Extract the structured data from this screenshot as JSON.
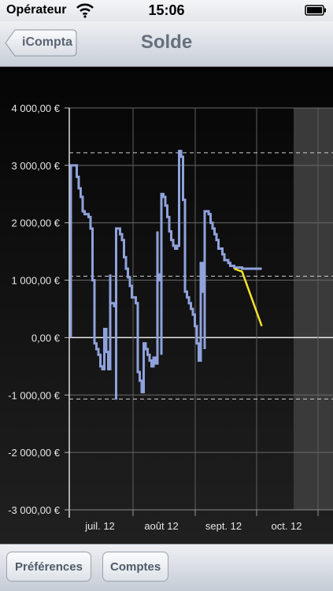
{
  "status_bar": {
    "carrier": "Opérateur",
    "time": "15:06"
  },
  "navbar": {
    "back_label": "iCompta",
    "title": "Solde"
  },
  "toolbar": {
    "preferences_label": "Préférences",
    "accounts_label": "Comptes"
  },
  "colors": {
    "balance_line": "#8fa2dc",
    "forecast_line": "#f0e22a",
    "reference_lines": "#cfcfcf"
  },
  "chart_data": {
    "type": "line",
    "title": "",
    "ylim": [
      -3000,
      4000
    ],
    "yticks": [
      4000,
      3000,
      2000,
      1000,
      0,
      -1000,
      -2000,
      -3000
    ],
    "ytick_labels": [
      "4 000,00 €",
      "3 000,00 €",
      "2 000,00 €",
      "1 000,00 €",
      "0,00 €",
      "-1 000,00 €",
      "-2 000,00 €",
      "-3 000,00 €"
    ],
    "x_ticks": [
      "juil. 12",
      "août 12",
      "sept. 12",
      "oct. 12"
    ],
    "reference_lines": [
      3220,
      1070,
      -1070
    ],
    "series": [
      {
        "color": "balance",
        "points": [
          [
            "2012-06-25",
            0
          ],
          [
            "2012-06-25",
            3000
          ],
          [
            "2012-06-27",
            3000
          ],
          [
            "2012-06-28",
            2800
          ],
          [
            "2012-06-29",
            2600
          ],
          [
            "2012-06-30",
            2450
          ],
          [
            "2012-07-01",
            2200
          ],
          [
            "2012-07-02",
            2150
          ],
          [
            "2012-07-04",
            2100
          ],
          [
            "2012-07-05",
            1900
          ],
          [
            "2012-07-06",
            1000
          ],
          [
            "2012-07-07",
            -100
          ],
          [
            "2012-07-08",
            -200
          ],
          [
            "2012-07-09",
            -300
          ],
          [
            "2012-07-10",
            -500
          ],
          [
            "2012-07-11",
            -550
          ],
          [
            "2012-07-12",
            150
          ],
          [
            "2012-07-13",
            -250
          ],
          [
            "2012-07-14",
            -550
          ],
          [
            "2012-07-15",
            1100
          ],
          [
            "2012-07-15",
            600
          ],
          [
            "2012-07-17",
            550
          ],
          [
            "2012-07-18",
            -1080
          ],
          [
            "2012-07-18",
            1900
          ],
          [
            "2012-07-20",
            1800
          ],
          [
            "2012-07-21",
            1700
          ],
          [
            "2012-07-22",
            1400
          ],
          [
            "2012-07-23",
            1200
          ],
          [
            "2012-07-24",
            1050
          ],
          [
            "2012-07-25",
            900
          ],
          [
            "2012-07-26",
            700
          ],
          [
            "2012-07-27",
            700
          ],
          [
            "2012-07-28",
            600
          ],
          [
            "2012-07-29",
            -600
          ],
          [
            "2012-07-30",
            -750
          ],
          [
            "2012-07-31",
            -950
          ],
          [
            "2012-08-01",
            -100
          ],
          [
            "2012-08-02",
            -200
          ],
          [
            "2012-08-03",
            -300
          ],
          [
            "2012-08-04",
            -400
          ],
          [
            "2012-08-05",
            -500
          ],
          [
            "2012-08-06",
            -350
          ],
          [
            "2012-08-07",
            -450
          ],
          [
            "2012-08-08",
            1850
          ],
          [
            "2012-08-08",
            1100
          ],
          [
            "2012-08-09",
            1000
          ],
          [
            "2012-08-10",
            -300
          ],
          [
            "2012-08-10",
            2500
          ],
          [
            "2012-08-11",
            2450
          ],
          [
            "2012-08-12",
            2300
          ],
          [
            "2012-08-13",
            2100
          ],
          [
            "2012-08-14",
            1850
          ],
          [
            "2012-08-15",
            1700
          ],
          [
            "2012-08-16",
            1600
          ],
          [
            "2012-08-17",
            1550
          ],
          [
            "2012-08-18",
            1600
          ],
          [
            "2012-08-19",
            3250
          ],
          [
            "2012-08-20",
            3150
          ],
          [
            "2012-08-21",
            2400
          ],
          [
            "2012-08-22",
            800
          ],
          [
            "2012-08-23",
            700
          ],
          [
            "2012-08-24",
            600
          ],
          [
            "2012-08-25",
            500
          ],
          [
            "2012-08-26",
            400
          ],
          [
            "2012-08-27",
            200
          ],
          [
            "2012-08-28",
            -100
          ],
          [
            "2012-08-29",
            -400
          ],
          [
            "2012-08-30",
            1300
          ],
          [
            "2012-08-31",
            800
          ],
          [
            "2012-09-01",
            1300
          ],
          [
            "2012-09-01",
            -200
          ],
          [
            "2012-09-01",
            2200
          ],
          [
            "2012-09-03",
            2150
          ],
          [
            "2012-09-04",
            2000
          ],
          [
            "2012-09-05",
            1900
          ],
          [
            "2012-09-06",
            1800
          ],
          [
            "2012-09-07",
            1700
          ],
          [
            "2012-09-08",
            1550
          ],
          [
            "2012-09-10",
            1450
          ],
          [
            "2012-09-11",
            1350
          ],
          [
            "2012-09-13",
            1300
          ],
          [
            "2012-09-14",
            1250
          ],
          [
            "2012-09-15",
            1250
          ],
          [
            "2012-09-16",
            1250
          ],
          [
            "2012-09-16",
            1220
          ],
          [
            "2012-09-20",
            1200
          ],
          [
            "2012-09-30",
            1200
          ]
        ]
      },
      {
        "color": "forecast",
        "points": [
          [
            "2012-09-16",
            1200
          ],
          [
            "2012-09-20",
            1150
          ],
          [
            "2012-09-30",
            200
          ]
        ]
      }
    ]
  }
}
